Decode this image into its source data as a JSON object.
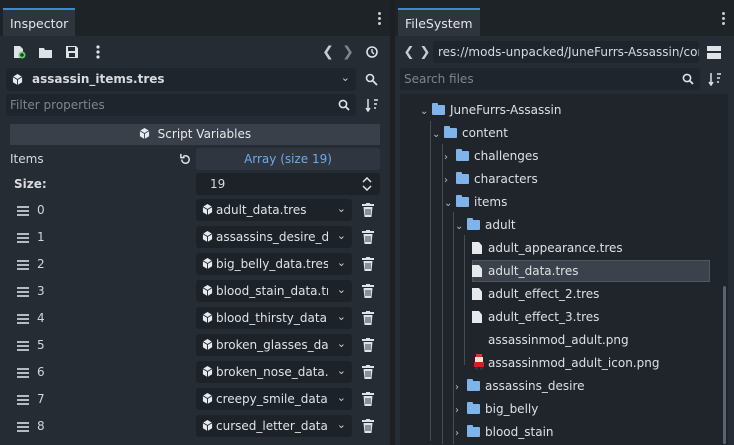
{
  "inspector": {
    "tab_label": "Inspector",
    "resource_name": "assassin_items.tres",
    "filter_placeholder": "Filter properties",
    "section_title": "Script Variables",
    "property_label": "Items",
    "array_label": "Array (size 19)",
    "size_label": "Size:",
    "size_value": "19",
    "items": [
      {
        "index": "0",
        "resource": "adult_data.tres"
      },
      {
        "index": "1",
        "resource": "assassins_desire_d"
      },
      {
        "index": "2",
        "resource": "big_belly_data.tres"
      },
      {
        "index": "3",
        "resource": "blood_stain_data.tr"
      },
      {
        "index": "4",
        "resource": "blood_thirsty_data.t"
      },
      {
        "index": "5",
        "resource": "broken_glasses_da"
      },
      {
        "index": "6",
        "resource": "broken_nose_data.t"
      },
      {
        "index": "7",
        "resource": "creepy_smile_data."
      },
      {
        "index": "8",
        "resource": "cursed_letter_data."
      }
    ]
  },
  "filesystem": {
    "tab_label": "FileSystem",
    "path": "res://mods-unpacked/JuneFurrs-Assassin/cont",
    "search_placeholder": "Search files",
    "tree": {
      "root": "JuneFurrs-Assassin",
      "content": "content",
      "challenges": "challenges",
      "characters": "characters",
      "items": "items",
      "adult": "adult",
      "files": [
        "adult_appearance.tres",
        "adult_data.tres",
        "adult_effect_2.tres",
        "adult_effect_3.tres",
        "assassinmod_adult.png",
        "assassinmod_adult_icon.png"
      ],
      "assassins_desire": "assassins_desire",
      "big_belly": "big_belly",
      "blood_stain": "blood_stain"
    }
  },
  "colors": {
    "accent": "#3a8ad6",
    "folder": "#7fb4ea",
    "link_text": "#6fa9ec",
    "panel_bg": "#262c33"
  }
}
